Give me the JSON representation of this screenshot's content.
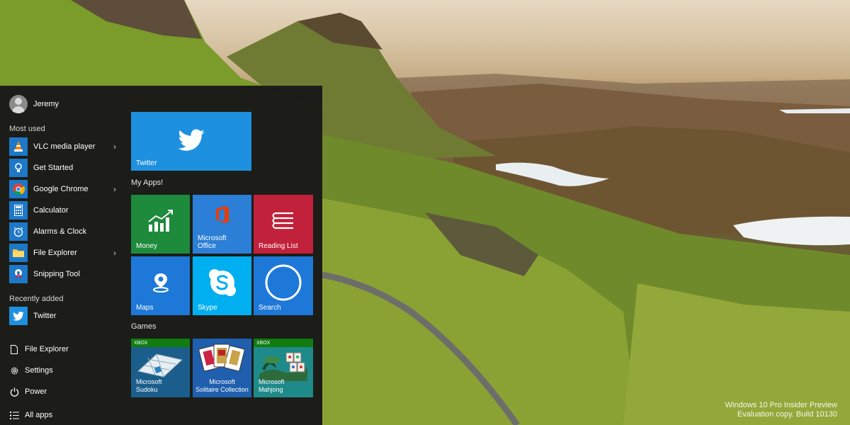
{
  "user": {
    "name": "Jeremy"
  },
  "most_used": {
    "title": "Most used",
    "items": [
      {
        "label": "VLC media player",
        "icon": "vlc-icon",
        "has_submenu": true
      },
      {
        "label": "Get Started",
        "icon": "get-started-icon",
        "has_submenu": false
      },
      {
        "label": "Google Chrome",
        "icon": "chrome-icon",
        "has_submenu": true
      },
      {
        "label": "Calculator",
        "icon": "calculator-icon",
        "has_submenu": false
      },
      {
        "label": "Alarms & Clock",
        "icon": "alarm-clock-icon",
        "has_submenu": false
      },
      {
        "label": "File Explorer",
        "icon": "folder-icon",
        "has_submenu": true
      },
      {
        "label": "Snipping Tool",
        "icon": "snipping-tool-icon",
        "has_submenu": false
      }
    ]
  },
  "recently_added": {
    "title": "Recently added",
    "items": [
      {
        "label": "Twitter",
        "icon": "twitter-icon"
      }
    ]
  },
  "system": {
    "file_explorer": "File Explorer",
    "settings": "Settings",
    "power": "Power",
    "all_apps": "All apps"
  },
  "tiles": {
    "twitter": "Twitter",
    "groups": {
      "apps": "My Apps!",
      "games": "Games"
    },
    "money": "Money",
    "office_line1": "Microsoft",
    "office_line2": "Office",
    "reading_list": "Reading List",
    "maps": "Maps",
    "skype": "Skype",
    "search": "Search",
    "sudoku_line1": "Microsoft",
    "sudoku_line2": "Sudoku",
    "solitaire_line1": "Microsoft",
    "solitaire_line2": "Solitaire Collection",
    "mahjong_line1": "Microsoft",
    "mahjong_line2": "Mahjong",
    "xbox_badge": "XBOX"
  },
  "watermark": {
    "line1": "Windows 10 Pro Insider Preview",
    "line2": "Evaluation copy. Build 10130"
  },
  "colors": {
    "accent_blue": "#1e90e0",
    "money_green": "#1e8a3c",
    "office_blue": "#2b7fd6",
    "reading_red": "#c1213a",
    "xbox_green": "#107c10"
  }
}
